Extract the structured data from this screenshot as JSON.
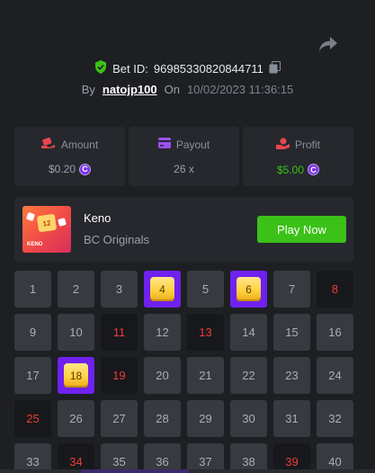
{
  "bet": {
    "label": "Bet ID:",
    "id": "96985330820844711"
  },
  "author": {
    "by_label": "By",
    "username": "natojp100",
    "on_label": "On",
    "date": "10/02/2023 11:36:15"
  },
  "stats": [
    {
      "label": "Amount",
      "value": "$0.20",
      "coin": "C",
      "color": "#9aa0ab"
    },
    {
      "label": "Payout",
      "value": "26 x",
      "color": "#9aa0ab"
    },
    {
      "label": "Profit",
      "value": "$5.00",
      "coin": "C",
      "color": "#3bc117"
    }
  ],
  "game": {
    "name": "Keno",
    "provider": "BC Originals",
    "play_label": "Play Now",
    "thumb_tile": "12",
    "thumb_label": "KENO"
  },
  "colors": {
    "hit": "#6f21ef",
    "miss_text": "#ed3c3c",
    "accent_green": "#3bc117"
  },
  "board": {
    "numbers": [
      1,
      2,
      3,
      4,
      5,
      6,
      7,
      8,
      9,
      10,
      11,
      12,
      13,
      14,
      15,
      16,
      17,
      18,
      19,
      20,
      21,
      22,
      23,
      24,
      25,
      26,
      27,
      28,
      29,
      30,
      31,
      32,
      33,
      34,
      35,
      36,
      37,
      38,
      39,
      40
    ],
    "hits": [
      4,
      6,
      18
    ],
    "misses": [
      8,
      11,
      13,
      19,
      25,
      34,
      39
    ]
  }
}
